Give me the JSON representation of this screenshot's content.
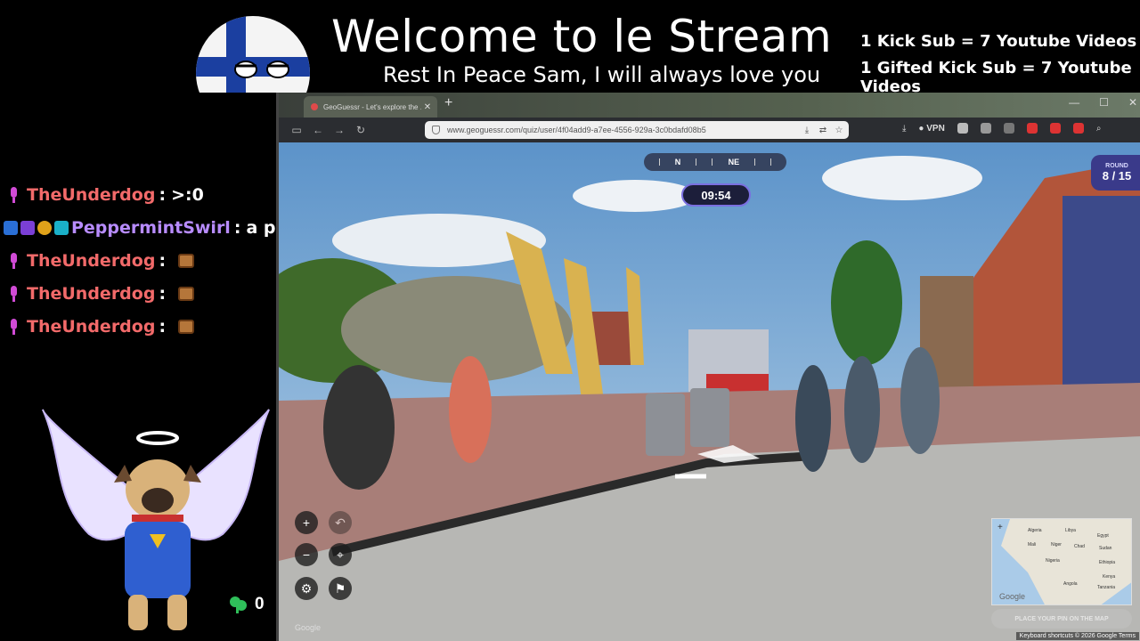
{
  "header": {
    "title": "Welcome to le Stream",
    "subtitle": "Rest In Peace Sam, I will always love you",
    "sub_info": [
      "1 Kick Sub = 7 Youtube Videos",
      "1 Gifted Kick Sub = 7 Youtube Videos"
    ]
  },
  "chat": {
    "messages": [
      {
        "user": "TheUnderdog",
        "user_color": "#f26a6a",
        "message": ">:0"
      },
      {
        "user": "PeppermintSwirl",
        "user_color": "#b88cff",
        "message": "a pa"
      },
      {
        "user": "TheUnderdog",
        "user_color": "#f26a6a",
        "message": ""
      },
      {
        "user": "TheUnderdog",
        "user_color": "#f26a6a",
        "message": ""
      },
      {
        "user": "TheUnderdog",
        "user_color": "#f26a6a",
        "message": ""
      }
    ],
    "separator": ":",
    "plant_count": "0"
  },
  "browser": {
    "tab_title": "GeoGuessr - Let's explore the ...",
    "new_tab": "+",
    "url": "www.geoguessr.com/quiz/user/4f04add9-a7ee-4556-929a-3c0bdafd08b5",
    "vpn_label": "VPN",
    "window_controls": [
      "—",
      "☐",
      "✕"
    ]
  },
  "game": {
    "compass": [
      "N",
      "NE"
    ],
    "timer": "09:54",
    "round_label": "ROUND",
    "round_value": "8 / 15",
    "guess_button": "PLACE YOUR PIN ON THE MAP",
    "google_logo": "Google",
    "footer": "Keyboard shortcuts  © 2026 Google  Terms",
    "minimap_labels": [
      "Algeria",
      "Libya",
      "Egypt",
      "Mali",
      "Niger",
      "Chad",
      "Sudan",
      "Nigeria",
      "Ethiopia",
      "Kenya",
      "Tanzania",
      "Angola",
      "Google"
    ]
  },
  "colors": {
    "accent": "#7a6fe0",
    "chat_mic": "#d14bd6",
    "round_bg": "#3a3a8a"
  }
}
